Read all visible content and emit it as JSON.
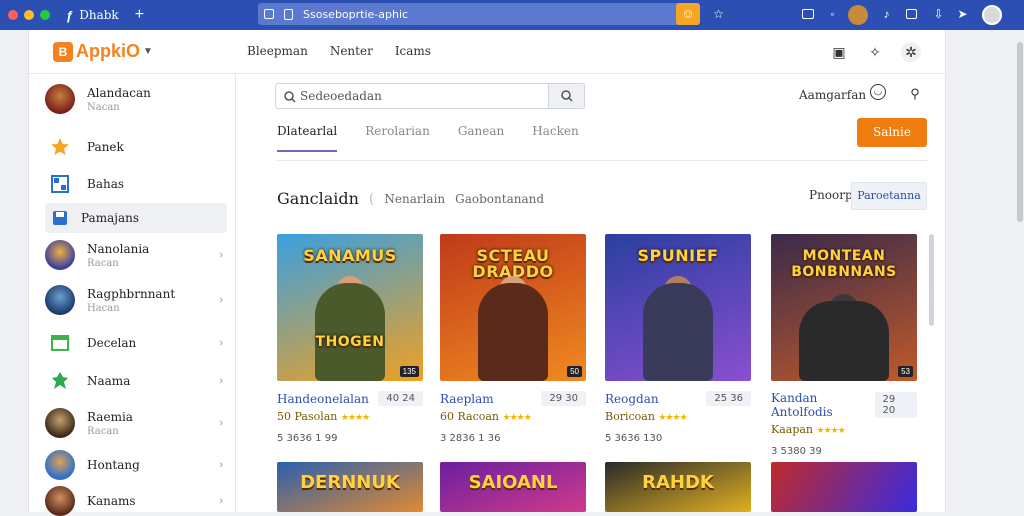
{
  "browser": {
    "tab_title": "Dhabk",
    "url": "Ssoseboprtie-aphic",
    "colors": {
      "bar": "#2b4fb3",
      "url": "#5a79cf",
      "accent": "#f5a623"
    }
  },
  "header": {
    "logo_text": "AppkiO",
    "logo_letter": "B",
    "nav": [
      "Bleepman",
      "Nenter",
      "Icams"
    ],
    "icons": [
      "save-icon",
      "star-icon",
      "settings-icon"
    ]
  },
  "sidebar": {
    "items": [
      {
        "label": "Alandacan",
        "sub": "Nacan",
        "type": "avatar",
        "color": "#7a1f1f"
      },
      {
        "label": "Panek",
        "sub": "",
        "type": "icon",
        "icon": "star-icon",
        "color": "#f5a623"
      },
      {
        "label": "Bahas",
        "sub": "",
        "type": "icon",
        "icon": "grid-icon",
        "color": "#2b6fd1"
      },
      {
        "label": "Pamajans",
        "sub": "",
        "type": "icon",
        "icon": "save-icon",
        "color": "#2b6fd1",
        "active": true
      },
      {
        "label": "Nanolania",
        "sub": "Racan",
        "type": "avatar",
        "color": "#3a3fa0",
        "chevron": true
      },
      {
        "label": "Ragphbrnnant",
        "sub": "Hacan",
        "type": "avatar",
        "color": "#2c6fa8",
        "chevron": true
      },
      {
        "label": "Decelan",
        "sub": "",
        "type": "icon",
        "icon": "window-icon",
        "color": "#3bb54a",
        "chevron": true
      },
      {
        "label": "Naama",
        "sub": "",
        "type": "icon",
        "icon": "leaf-icon",
        "color": "#2fa84f",
        "chevron": true
      },
      {
        "label": "Raemia",
        "sub": "Racan",
        "type": "avatar",
        "color": "#5a4632",
        "chevron": true
      },
      {
        "label": "Hontang",
        "sub": "",
        "type": "avatar",
        "color": "#2b6fd1",
        "chevron": true
      },
      {
        "label": "Kanams",
        "sub": "",
        "type": "avatar",
        "color": "#7a3f2a",
        "chevron": true
      }
    ]
  },
  "main": {
    "search_placeholder": "Sedeoedadan",
    "manager_label": "Aamgarfan",
    "tabs": [
      {
        "label": "Dlatearlal",
        "active": true
      },
      {
        "label": "Rerolarian",
        "active": false
      },
      {
        "label": "Ganean",
        "active": false
      },
      {
        "label": "Hacken",
        "active": false
      }
    ],
    "action_button": "Salnie",
    "section_title": "Ganclaidn",
    "section_sub1": "Nenarlain",
    "section_sub2": "Gaobontanand",
    "sort_label": "Pnoorp",
    "filter_label": "Paroetanna"
  },
  "cards": [
    {
      "art_title": "SANAMUS",
      "art_bottom": "THOGEN",
      "badge": "135",
      "name": "Handeonelalan",
      "price": "40 24",
      "meta": "50 Pasolan",
      "count": "5 3636 1 99",
      "colors": [
        "#3aa0e0",
        "#f0a020"
      ]
    },
    {
      "art_title": "SCTEAU DRADDO",
      "art_bottom": "",
      "badge": "50",
      "name": "Raeplam",
      "price": "29 30",
      "meta": "60 Racoan",
      "count": "3 2836 1 36",
      "colors": [
        "#c03a1a",
        "#f08a20"
      ]
    },
    {
      "art_title": "SPUNIEF",
      "art_bottom": "",
      "badge": "",
      "name": "Reogdan",
      "price": "25 36",
      "meta": "Boricoan",
      "count": "5 3636 130",
      "colors": [
        "#2a3fa0",
        "#8a4fd0"
      ]
    },
    {
      "art_title": "MONTEAN BONBNNANS",
      "art_bottom": "",
      "badge": "53",
      "name": "Kandan Antolfodis",
      "price": "29 20",
      "meta": "Kaapan",
      "count": "3 5380 39",
      "colors": [
        "#3a2a4a",
        "#c05a2a"
      ]
    }
  ],
  "cards_row2": [
    {
      "art_title": "DERNNUK",
      "colors": [
        "#2a5fb0",
        "#e08a30"
      ]
    },
    {
      "art_title": "SAIOANL",
      "colors": [
        "#6a1fa0",
        "#d03a8a"
      ]
    },
    {
      "art_title": "RAHDK",
      "colors": [
        "#2a2a2a",
        "#e0b020"
      ]
    },
    {
      "art_title": "",
      "colors": [
        "#c02a2a",
        "#3a2ae0"
      ]
    }
  ]
}
